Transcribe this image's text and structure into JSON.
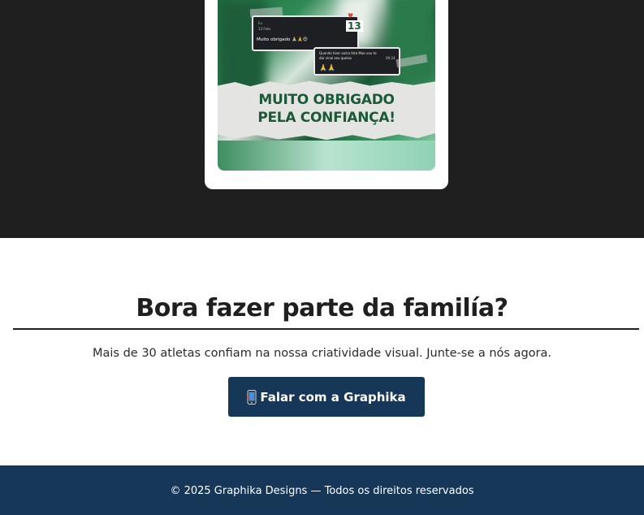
{
  "testimonial": {
    "chat_top": {
      "sender": "Eu",
      "meta": "13 Foto",
      "message": "Muito obrigado 🙏🙏😊",
      "thumb_number": "13"
    },
    "chat_reply": {
      "message_line1": "Quando tiver outra foto Moo vou te",
      "message_line2": "dar sinal seu queiso",
      "time": "09:24",
      "emoji": "🙏🙏"
    },
    "banner_line1": "MUITO OBRIGADO",
    "banner_line2": "PELA CONFIANÇA!"
  },
  "cta": {
    "title": "Bora fazer parte da familía?",
    "subtitle": "Mais de 30 atletas confiam na nossa criatividade visual. Junte-se a nós agora.",
    "button_label": "Falar com a Graphika",
    "button_icon": "mobile-phone-icon"
  },
  "footer": {
    "text": "© 2025 Graphika Designs — Todos os direitos reservados"
  },
  "colors": {
    "dark_bg": "#1f1f1f",
    "brand_navy": "#163758",
    "brand_green": "#1a5a36"
  }
}
